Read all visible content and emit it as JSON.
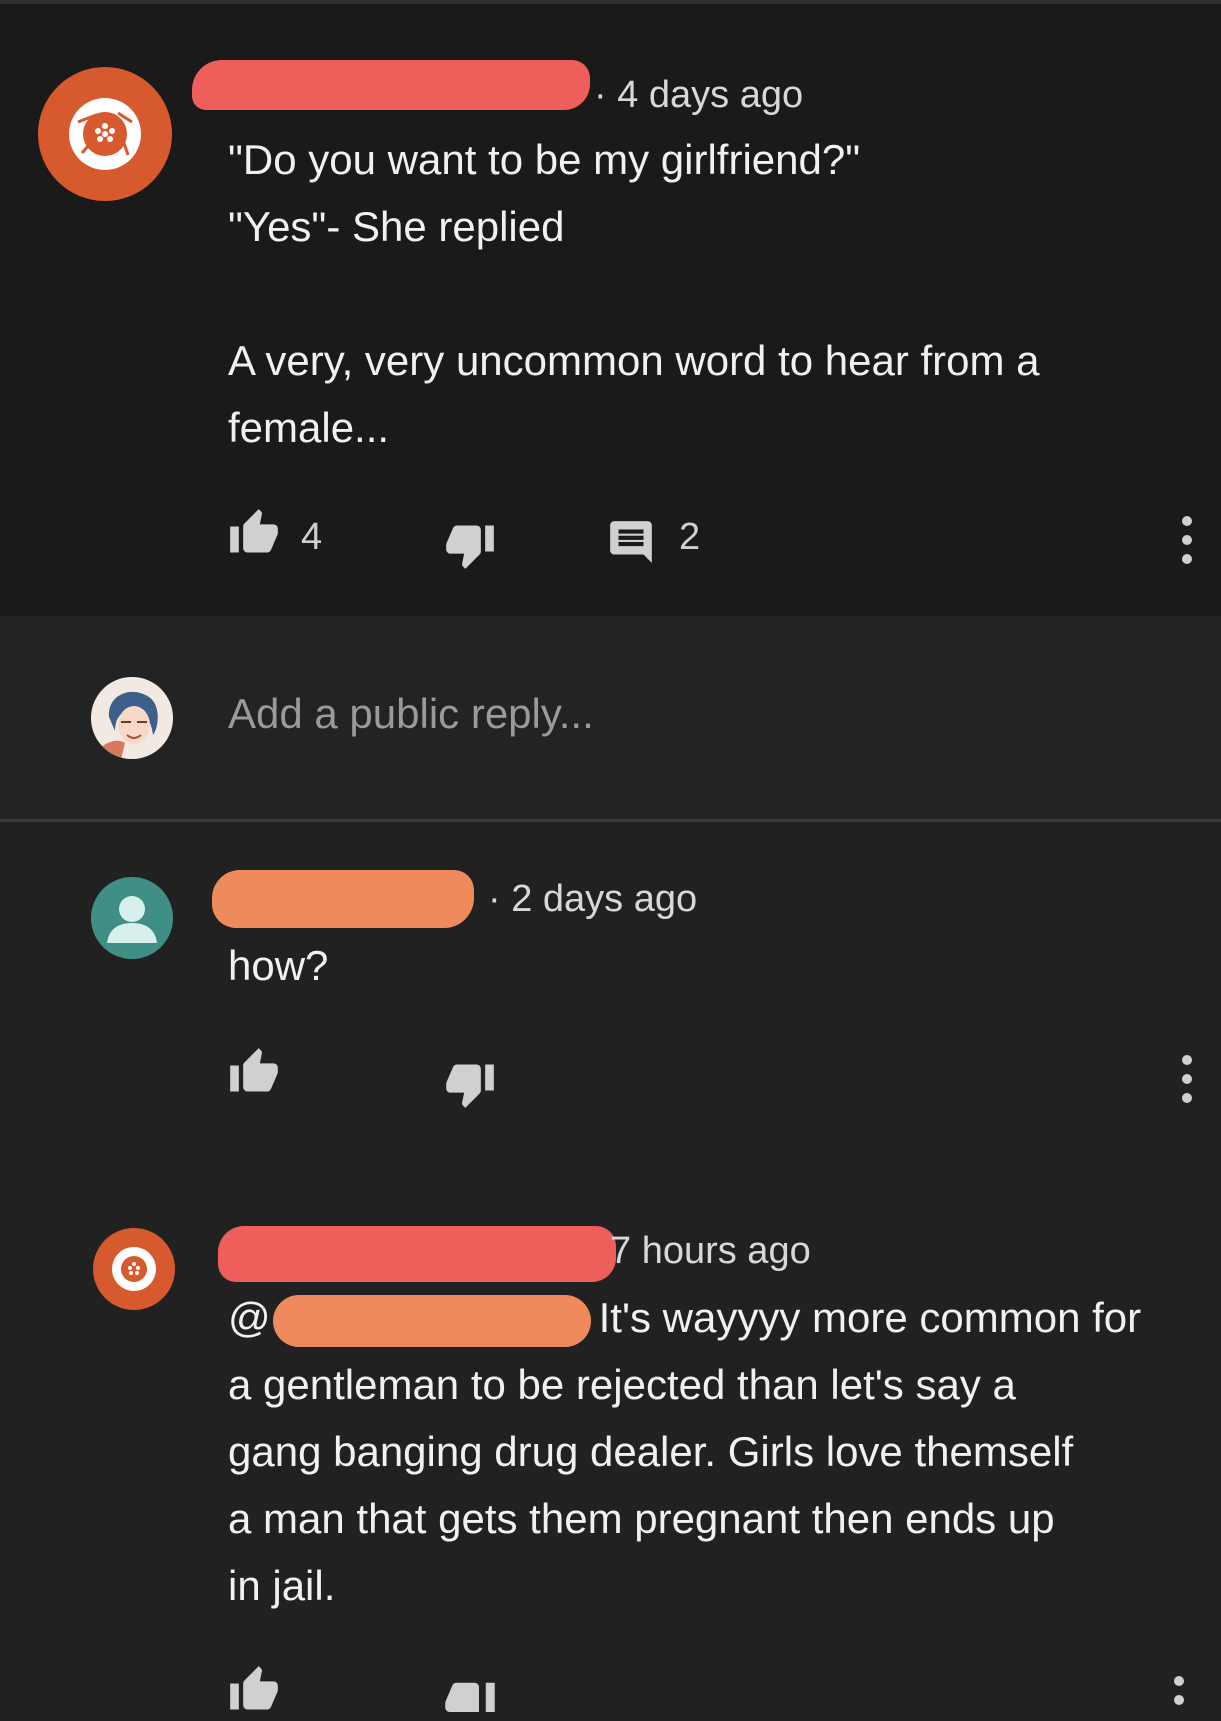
{
  "comment": {
    "time": "4 days ago",
    "lines": [
      "\"Do you want to be my girlfriend?\"",
      "\"Yes\"- She replied",
      "",
      "A very, very uncommon word to hear from a",
      "female..."
    ],
    "likes": "4",
    "replies_count": "2"
  },
  "reply_box": {
    "placeholder": "Add a public reply..."
  },
  "replies": [
    {
      "time": "2 days ago",
      "lines": [
        "how?"
      ]
    },
    {
      "time": "7 hours ago",
      "mention_prefix": "@",
      "lines": [
        "It's wayyyy more common for",
        "a gentleman to be rejected than let's say a",
        "gang banging drug dealer. Girls love themself",
        "a man that gets them pregnant then ends up",
        "in jail."
      ]
    }
  ],
  "colors": {
    "background": "#212121",
    "main_comment_bg": "#1a1a1a",
    "avatar_orange": "#d65a2e",
    "avatar_teal": "#3f8f86",
    "redaction_red": "#ee5f5b",
    "redaction_orange": "#ef8a5c"
  },
  "icons": [
    "thumb-up-icon",
    "thumb-down-icon",
    "comment-icon",
    "more-vert-icon",
    "camera-aperture-icon",
    "default-user-icon"
  ]
}
